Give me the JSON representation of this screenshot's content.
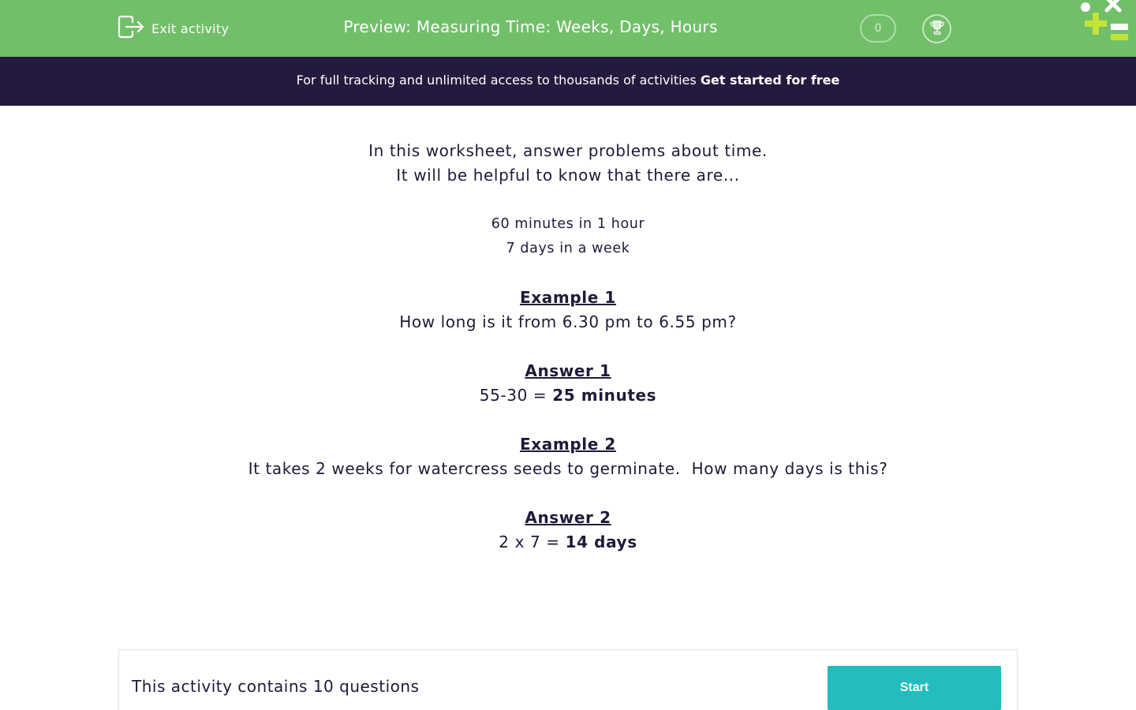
{
  "header": {
    "exit_label": "Exit activity",
    "title": "Preview: Measuring Time: Weeks, Days, Hours",
    "score": "0",
    "background_color": "#72bf6a"
  },
  "banner": {
    "text": "For full tracking and unlimited access to thousands of activities ",
    "cta": "Get started for free",
    "background_color": "#231a3d"
  },
  "content": {
    "intro_line1": "In this worksheet, answer problems about time.",
    "intro_line2": "It will be helpful to know that there are...",
    "fact1": "60 minutes in 1 hour",
    "fact2": "7 days in a week",
    "example1_heading": "Example 1",
    "example1_text": "How long is it from 6.30 pm to 6.55 pm?",
    "answer1_heading": "Answer 1",
    "answer1_expr": "55-30 = ",
    "answer1_result": "25 minutes",
    "example2_heading": "Example 2",
    "example2_text": "It takes 2 weeks for watercress seeds to germinate.  How many days is this?",
    "answer2_heading": "Answer 2",
    "answer2_expr": "2 x 7 = ",
    "answer2_result": "14 days"
  },
  "footer": {
    "question_count_text": "This activity contains 10 questions",
    "start_label": "Start",
    "start_color": "#24bcbc"
  },
  "icons": {
    "exit": "exit-icon",
    "trophy": "trophy-icon",
    "decoration": "math-symbols-decoration"
  }
}
